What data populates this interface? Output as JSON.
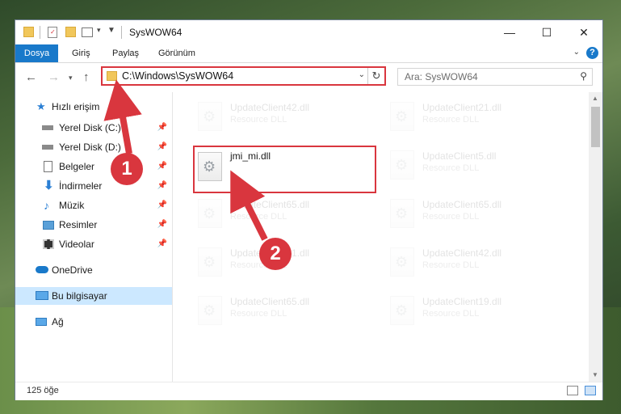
{
  "window": {
    "title": "SysWOW64",
    "controls": {
      "minimize": "—",
      "maximize": "☐",
      "close": "✕"
    }
  },
  "ribbon": {
    "tabs": [
      "Dosya",
      "Giriş",
      "Paylaş",
      "Görünüm"
    ],
    "help": "?"
  },
  "address": {
    "path": "C:\\Windows\\SysWOW64",
    "search_placeholder": "Ara: SysWOW64"
  },
  "nav": {
    "quick_access": "Hızlı erişim",
    "items": [
      {
        "label": "Yerel Disk (C:)",
        "pinned": true
      },
      {
        "label": "Yerel Disk (D:)",
        "pinned": true
      },
      {
        "label": "Belgeler",
        "pinned": true
      },
      {
        "label": "İndirmeler",
        "pinned": true
      },
      {
        "label": "Müzik",
        "pinned": true
      },
      {
        "label": "Resimler",
        "pinned": true
      },
      {
        "label": "Videolar",
        "pinned": true
      }
    ],
    "onedrive": "OneDrive",
    "this_pc": "Bu bilgisayar",
    "network": "Ağ"
  },
  "files": {
    "highlighted": {
      "name": "jmi_mi.dll"
    },
    "faded": [
      {
        "name": "UpdateClient42.dll",
        "type": "Resource DLL"
      },
      {
        "name": "UpdateClient21.dll",
        "type": "Resource DLL"
      },
      {
        "name": "UpdateClient5.dll",
        "type": "Resource DLL"
      },
      {
        "name": "UpdateClient65.dll",
        "type": "Resource DLL"
      },
      {
        "name": "UpdateClient65.dll",
        "type": "Resource DLL"
      },
      {
        "name": "UpdateClient21.dll",
        "type": "Resource DLL"
      },
      {
        "name": "UpdateClient42.dll",
        "type": "Resource DLL"
      },
      {
        "name": "UpdateClient65.dll",
        "type": "Resource DLL"
      },
      {
        "name": "UpdateClient19.dll",
        "type": "Resource DLL"
      }
    ]
  },
  "status": {
    "count": "125 öğe"
  },
  "annotations": {
    "step1": "1",
    "step2": "2"
  },
  "colors": {
    "accent": "#1979ca",
    "highlight": "#d9363e",
    "selection": "#cce8ff"
  }
}
